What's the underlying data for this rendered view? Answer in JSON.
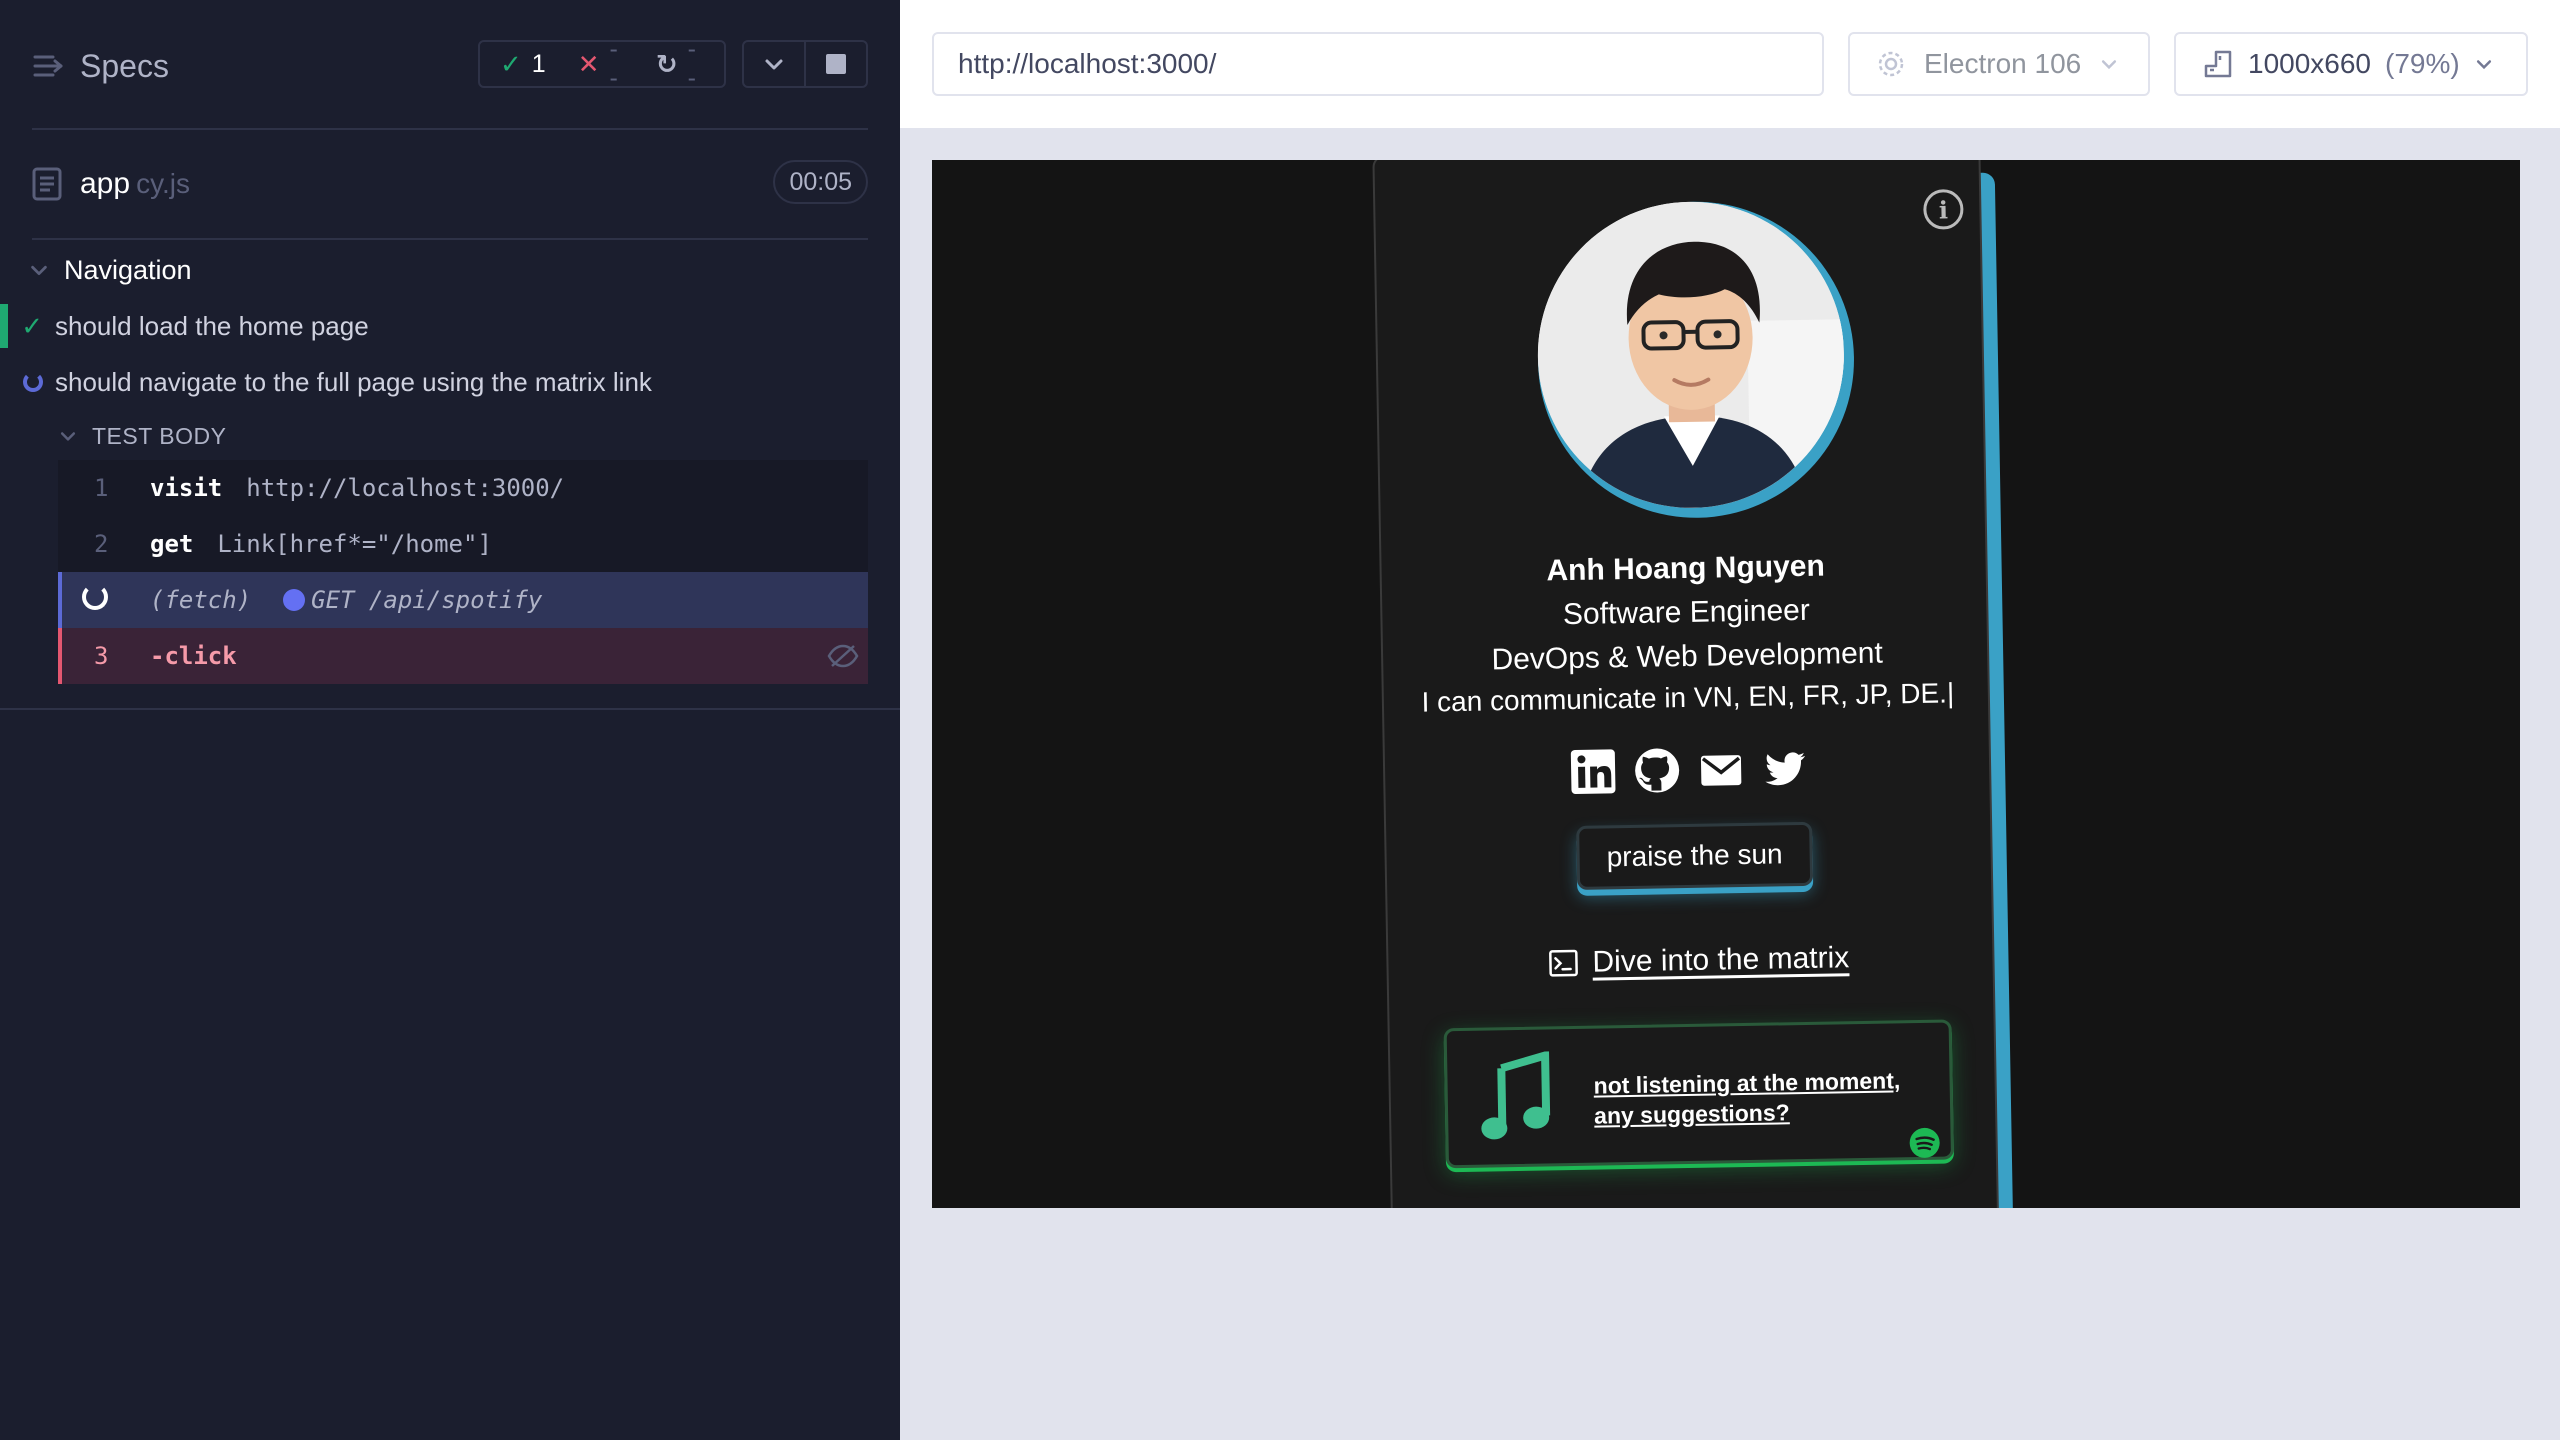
{
  "reporter": {
    "specs_label": "Specs",
    "stats": {
      "passed": "1",
      "failed": "--",
      "pending": "--"
    },
    "spec": {
      "name": "app",
      "ext": "cy.js",
      "duration": "00:05"
    },
    "suite": "Navigation",
    "tests": [
      {
        "title": "should load the home page",
        "state": "passed"
      },
      {
        "title": "should navigate to the full page using the matrix link",
        "state": "running"
      }
    ],
    "test_body_label": "TEST BODY",
    "commands": [
      {
        "num": "1",
        "name": "visit",
        "message": "http://localhost:3000/"
      },
      {
        "num": "2",
        "name": "get",
        "message": "Link[href*=\"/home\"]"
      },
      {
        "num": "",
        "name": "(fetch)",
        "message": "GET /api/spotify"
      },
      {
        "num": "3",
        "name": "-click",
        "message": ""
      }
    ]
  },
  "aut": {
    "url": "http://localhost:3000/",
    "browser": "Electron 106",
    "viewport": "1000x660",
    "zoom": "(79%)"
  },
  "page": {
    "name": "Anh Hoang Nguyen",
    "role": "Software Engineer",
    "focus": "DevOps & Web Development",
    "languages": "I can communicate in VN, EN, FR, JP, DE.|",
    "button": "praise the sun",
    "matrix_link": "Dive into the matrix",
    "spotify_text": "not listening at the moment, any suggestions?"
  },
  "colors": {
    "accent": "#3aa1c6",
    "pass": "#1fa971",
    "fail": "#e45770",
    "spotify": "#1db954"
  },
  "icons": [
    "specs-icon",
    "check-icon",
    "x-icon",
    "spinner-icon",
    "chevron-down-icon",
    "stop-icon",
    "file-icon",
    "eye-hidden-icon",
    "gear-icon",
    "viewport-icon",
    "info-icon",
    "linkedin-icon",
    "github-icon",
    "mail-icon",
    "twitter-icon",
    "terminal-icon",
    "music-note-icon",
    "spotify-icon"
  ]
}
